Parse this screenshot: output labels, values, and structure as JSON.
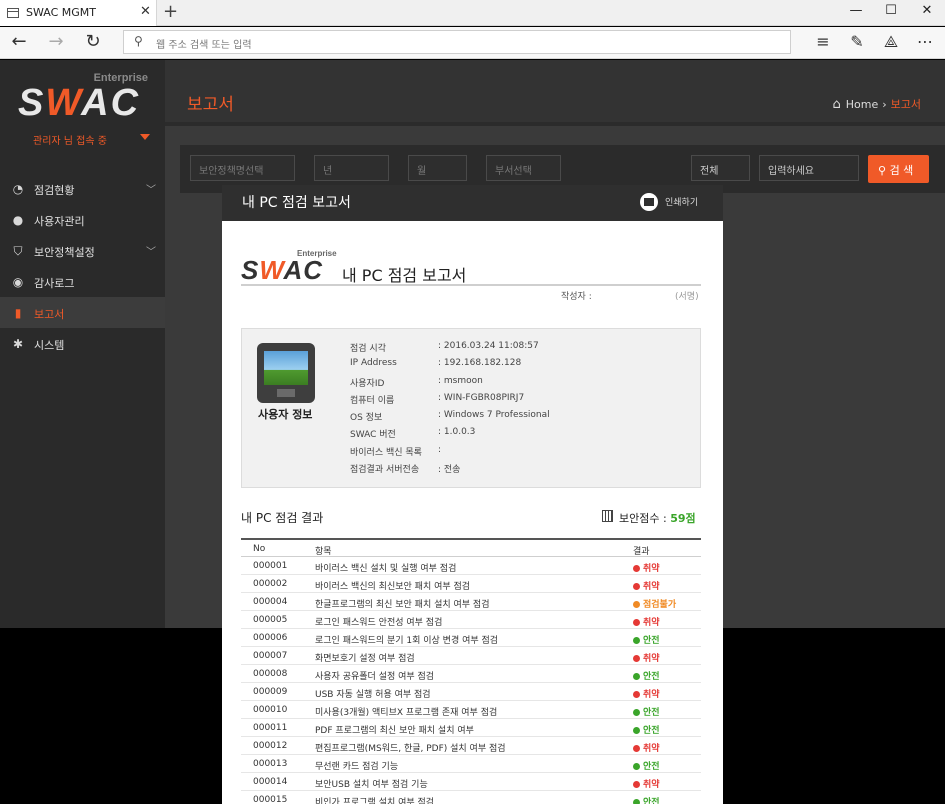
{
  "browser": {
    "tab_title": "SWAC MGMT",
    "tab_close": "✕",
    "new_tab": "+",
    "address_placeholder": "웹 주소 검색 또는 입력"
  },
  "sidebar": {
    "logo_enterprise": "Enterprise",
    "logo_pre": "S",
    "logo_w": "W",
    "logo_post": "AC",
    "admin_status": "관리자 님 접속 중",
    "items": [
      {
        "label": "점검현황",
        "icon": "dashboard-icon",
        "glyph": "◔",
        "chevron": true,
        "active": false
      },
      {
        "label": "사용자관리",
        "icon": "user-icon",
        "glyph": "●",
        "chevron": false,
        "active": false
      },
      {
        "label": "보안정책설정",
        "icon": "shield-icon",
        "glyph": "⛉",
        "chevron": true,
        "active": false
      },
      {
        "label": "감사로그",
        "icon": "camera-icon",
        "glyph": "◉",
        "chevron": false,
        "active": false
      },
      {
        "label": "보고서",
        "icon": "document-icon",
        "glyph": "▮",
        "chevron": false,
        "active": true
      },
      {
        "label": "시스템",
        "icon": "gear-icon",
        "glyph": "✱",
        "chevron": false,
        "active": false
      }
    ]
  },
  "header": {
    "title": "보고서",
    "breadcrumb_home": "Home",
    "breadcrumb_current": "보고서"
  },
  "filters": {
    "policy_placeholder": "보안정책명선택",
    "year_placeholder": "년",
    "month_placeholder": "월",
    "dept_placeholder": "부서선택",
    "scope_value": "전체",
    "keyword_placeholder": "입력하세요",
    "search_label": "검 색"
  },
  "report": {
    "header_title": "내 PC 점검 보고서",
    "print_label": "인쇄하기",
    "logo_enterprise": "Enterprise",
    "title": "내 PC 점검 보고서",
    "writer_label": "작성자 :",
    "sign_label": "(서명)",
    "user_info_label": "사용자 정보",
    "info": [
      {
        "key": "점검 시각",
        "value": ": 2016.03.24 11:08:57"
      },
      {
        "key": "IP Address",
        "value": ": 192.168.182.128"
      },
      {
        "key": "사용자ID",
        "value": ": msmoon"
      },
      {
        "key": "컴퓨터 이름",
        "value": ": WIN-FGBR08PIRJ7"
      },
      {
        "key": "OS 정보",
        "value": ": Windows 7 Professional"
      },
      {
        "key": "SWAC 버전",
        "value": ": 1.0.0.3"
      },
      {
        "key": "바이러스 백신 목록",
        "value": ":"
      },
      {
        "key": "점검결과 서버전송",
        "value": ": 전송"
      }
    ],
    "result_title": "내 PC 점검 결과",
    "score_label": "보안점수 :",
    "score_value": "59점",
    "columns": {
      "no": "No",
      "item": "항목",
      "result": "결과"
    },
    "rows": [
      {
        "no": "000001",
        "item": "바이러스 백신 설치 및 실행 여부 점검",
        "result": "취약",
        "color": "#e53935"
      },
      {
        "no": "000002",
        "item": "바이러스 백신의 최신보안 패치 여부 점검",
        "result": "취약",
        "color": "#e53935"
      },
      {
        "no": "000004",
        "item": "한글프로그램의 최신 보안 패치 설치 여부 점검",
        "result": "점검불가",
        "color": "#f08a24"
      },
      {
        "no": "000005",
        "item": "로그인 패스워드 안전성 여부 점검",
        "result": "취약",
        "color": "#e53935"
      },
      {
        "no": "000006",
        "item": "로그인 패스워드의 분기 1회 이상 변경 여부 점검",
        "result": "안전",
        "color": "#3aa52a"
      },
      {
        "no": "000007",
        "item": "화면보호기 설정 여부 점검",
        "result": "취약",
        "color": "#e53935"
      },
      {
        "no": "000008",
        "item": "사용자 공유폴더 설정 여부 점검",
        "result": "안전",
        "color": "#3aa52a"
      },
      {
        "no": "000009",
        "item": "USB 자동 실행 허용 여부 점검",
        "result": "취약",
        "color": "#e53935"
      },
      {
        "no": "000010",
        "item": "미사용(3개월) 액티브X 프로그램 존재 여부 점검",
        "result": "안전",
        "color": "#3aa52a"
      },
      {
        "no": "000011",
        "item": "PDF 프로그램의 최신 보안 패치 설치 여부",
        "result": "안전",
        "color": "#3aa52a"
      },
      {
        "no": "000012",
        "item": "편집프로그램(MS워드, 한글, PDF) 설치 여부 점검",
        "result": "취약",
        "color": "#e53935"
      },
      {
        "no": "000013",
        "item": "무선랜 카드 점검 기능",
        "result": "안전",
        "color": "#3aa52a"
      },
      {
        "no": "000014",
        "item": "보안USB 설치 여부 점검 기능",
        "result": "취약",
        "color": "#e53935"
      },
      {
        "no": "000015",
        "item": "비인가 프로그램 설치 여부 점검",
        "result": "안전",
        "color": "#3aa52a"
      }
    ]
  }
}
